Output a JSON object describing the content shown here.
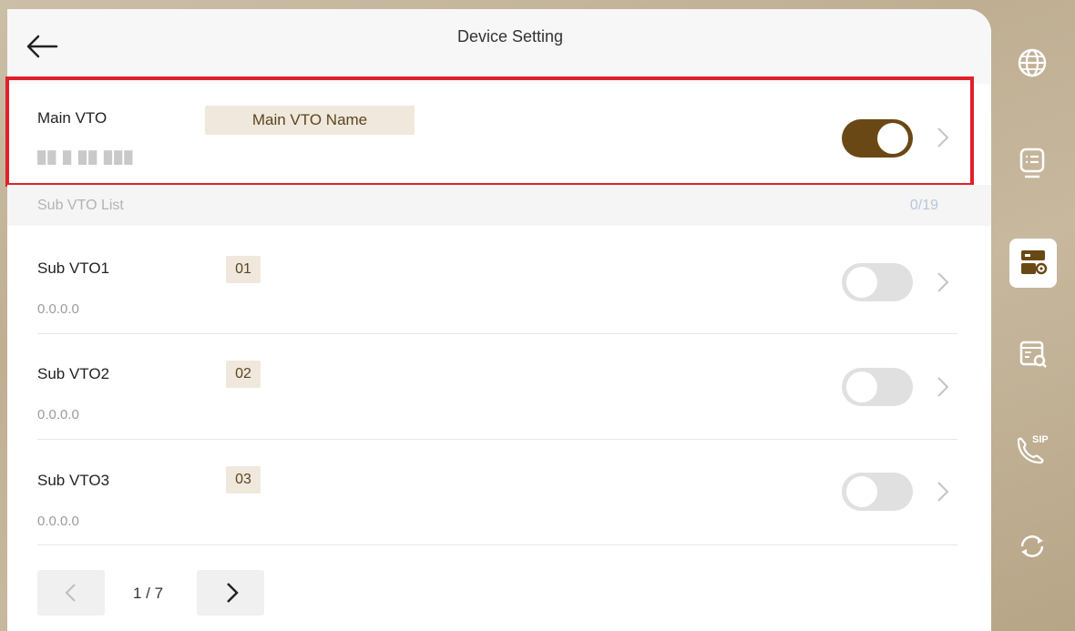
{
  "header": {
    "title": "Device Setting"
  },
  "main_vto": {
    "label": "Main VTO",
    "name": "Main VTO Name",
    "ip": "██ █ ██ ███",
    "enabled": true
  },
  "sub_list": {
    "label": "Sub VTO List",
    "count": "0/19"
  },
  "sub_vtos": [
    {
      "label": "Sub VTO1",
      "tag": "01",
      "ip": "0.0.0.0",
      "enabled": false
    },
    {
      "label": "Sub VTO2",
      "tag": "02",
      "ip": "0.0.0.0",
      "enabled": false
    },
    {
      "label": "Sub VTO3",
      "tag": "03",
      "ip": "0.0.0.0",
      "enabled": false
    }
  ],
  "pager": {
    "page_text": "1 / 7"
  },
  "sidebar": [
    {
      "icon": "globe-icon",
      "active": false
    },
    {
      "icon": "list-icon",
      "active": false
    },
    {
      "icon": "device-settings-icon",
      "active": true
    },
    {
      "icon": "device-search-icon",
      "active": false
    },
    {
      "icon": "sip-call-icon",
      "active": false
    },
    {
      "icon": "refresh-icon",
      "active": false
    }
  ],
  "colors": {
    "accent": "#6a4816",
    "highlight_border": "#e0202a",
    "tag_bg": "#f0e8dc"
  }
}
